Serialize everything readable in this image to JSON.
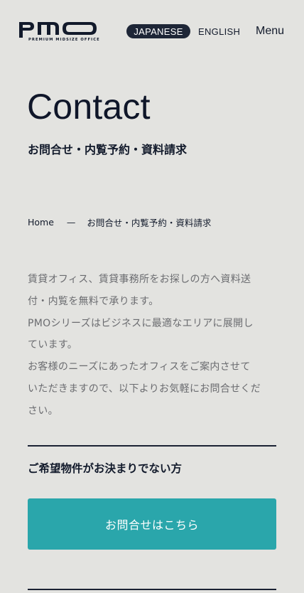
{
  "header": {
    "logo_text": "pmo",
    "logo_tagline": "PREMIUM MIDSIZE OFFICE",
    "lang_active": "JAPANESE",
    "lang_other": "ENGLISH",
    "menu_label": "Menu"
  },
  "page": {
    "title": "Contact",
    "subtitle": "お問合せ・内覧予約・資料請求"
  },
  "breadcrumb": {
    "home": "Home",
    "separator": "—",
    "current": "お問合せ・内覧予約・資料請求"
  },
  "intro": {
    "lines": [
      "賃貸オフィス、賃貸事務所をお探しの方へ資料送",
      "付・内覧を無料で承ります。",
      "PMOシリーズはビジネスに最適なエリアに展開し",
      "ています。",
      "お客様のニーズにあったオフィスをご案内させて",
      "いただきますので、以下よりお気軽にお問合せくだ",
      "さい。"
    ]
  },
  "section": {
    "heading": "ご希望物件がお決まりでない方",
    "button_label": "お問合せはこちら"
  },
  "colors": {
    "background": "#e3e3e0",
    "text": "#121a2b",
    "accent": "#2aa6ab",
    "muted_text": "#6b6c70"
  }
}
